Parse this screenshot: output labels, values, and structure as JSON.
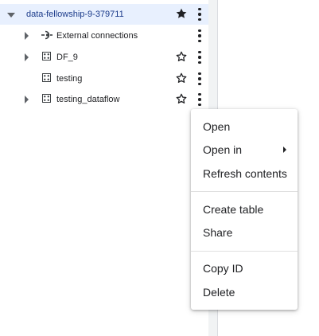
{
  "tree": {
    "project": {
      "label": "data-fellowship-9-379711",
      "starred": true
    },
    "items": [
      {
        "label": "External connections",
        "icon": "external-connection-icon",
        "expandable": true,
        "starred": null
      },
      {
        "label": "DF_9",
        "icon": "dataset-icon",
        "expandable": true,
        "starred": false
      },
      {
        "label": "testing",
        "icon": "dataset-icon",
        "expandable": false,
        "starred": false
      },
      {
        "label": "testing_dataflow",
        "icon": "dataset-icon",
        "expandable": true,
        "starred": false
      }
    ]
  },
  "context_menu": {
    "open": "Open",
    "open_in": "Open in",
    "refresh": "Refresh contents",
    "create_table": "Create table",
    "share": "Share",
    "copy_id": "Copy ID",
    "delete": "Delete"
  },
  "colors": {
    "selected_row_bg": "#e8f0fe",
    "selected_text": "#1a3a8a",
    "icon": "#3c4043"
  }
}
